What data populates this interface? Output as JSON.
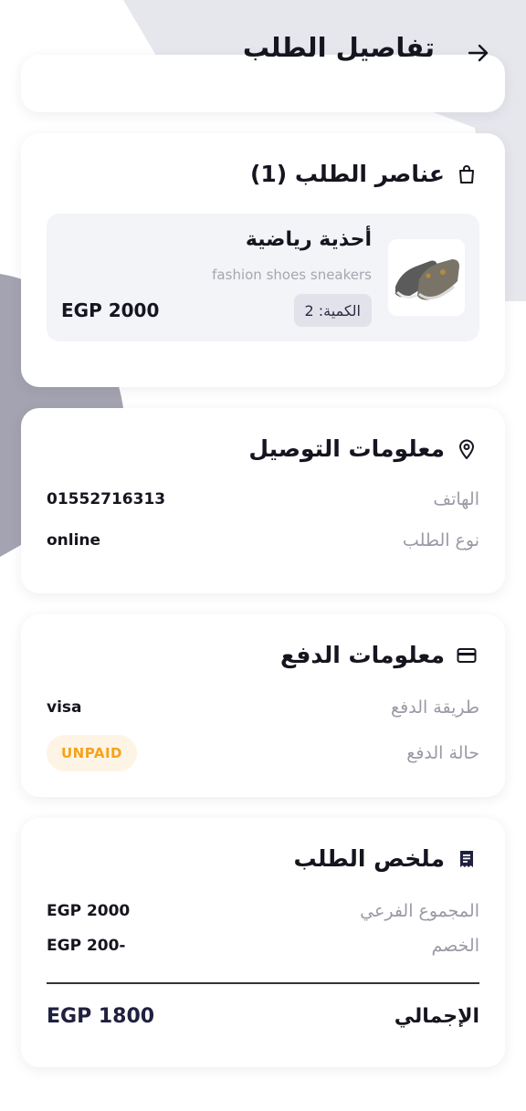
{
  "header": {
    "title": "تفاصيل الطلب",
    "back_icon": "arrow-right-icon"
  },
  "items_card": {
    "title": "عناصر الطلب (1)",
    "icon": "shopping-bag-icon",
    "item": {
      "name": "أحذية رياضية",
      "description": "fashion shoes sneakers",
      "quantity_label": "الكمية: 2",
      "price": "EGP 2000"
    }
  },
  "delivery_card": {
    "title": "معلومات التوصيل",
    "icon": "map-pin-icon",
    "rows": [
      {
        "label": "الهاتف",
        "value": "01552716313"
      },
      {
        "label": "نوع الطلب",
        "value": "online"
      }
    ]
  },
  "payment_card": {
    "title": "معلومات الدفع",
    "icon": "credit-card-icon",
    "method_label": "طريقة الدفع",
    "method_value": "visa",
    "status_label": "حالة الدفع",
    "status_value": "UNPAID"
  },
  "summary_card": {
    "title": "ملخص الطلب",
    "icon": "receipt-icon",
    "subtotal_label": "المجموع الفرعي",
    "subtotal_value": "EGP 2000",
    "discount_label": "الخصم",
    "discount_value": "EGP 200-",
    "total_label": "الإجمالي",
    "total_value": "EGP 1800"
  },
  "colors": {
    "accent_dark": "#20203f",
    "status_warning": "#f5a21b",
    "status_warning_bg": "#fef4e6",
    "bg_shape": "#e6e7ed",
    "bg_shape_dark": "#a3a3b1"
  }
}
